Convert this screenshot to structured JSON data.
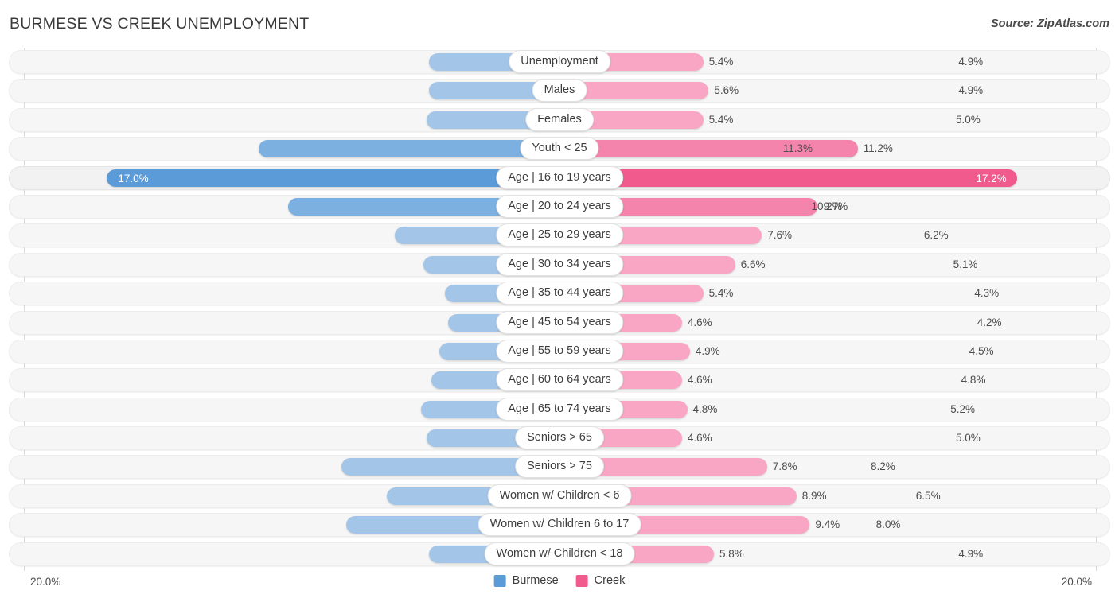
{
  "header": {
    "title": "BURMESE VS CREEK UNEMPLOYMENT",
    "source": "Source: ZipAtlas.com"
  },
  "footer": {
    "axis_left": "20.0%",
    "axis_right": "20.0%",
    "legend": [
      {
        "label": "Burmese",
        "color": "#5b9bd8",
        "icon": "legend-swatch"
      },
      {
        "label": "Creek",
        "color": "#f05a8c",
        "icon": "legend-swatch"
      }
    ]
  },
  "chart_data": {
    "type": "bar",
    "subtype": "diverging-bidirectional",
    "title": "BURMESE VS CREEK UNEMPLOYMENT",
    "xlabel": "",
    "ylabel": "",
    "xlim": [
      0,
      20.0
    ],
    "axis_max_label": "20.0%",
    "grid": false,
    "legend_position": "bottom-center",
    "series": [
      {
        "name": "Burmese",
        "side": "left",
        "color": "#5b9bd8",
        "values": [
          4.9,
          4.9,
          5.0,
          11.3,
          17.0,
          10.2,
          6.2,
          5.1,
          4.3,
          4.2,
          4.5,
          4.8,
          5.2,
          5.0,
          8.2,
          6.5,
          8.0,
          4.9
        ]
      },
      {
        "name": "Creek",
        "side": "right",
        "color": "#f05a8c",
        "values": [
          5.4,
          5.6,
          5.4,
          11.2,
          17.2,
          9.7,
          7.6,
          6.6,
          5.4,
          4.6,
          4.9,
          4.6,
          4.8,
          4.6,
          7.8,
          8.9,
          9.4,
          5.8
        ]
      }
    ],
    "categories": [
      "Unemployment",
      "Males",
      "Females",
      "Youth < 25",
      "Age | 16 to 19 years",
      "Age | 20 to 24 years",
      "Age | 25 to 29 years",
      "Age | 30 to 34 years",
      "Age | 35 to 44 years",
      "Age | 45 to 54 years",
      "Age | 55 to 59 years",
      "Age | 60 to 64 years",
      "Age | 65 to 74 years",
      "Seniors > 65",
      "Seniors > 75",
      "Women w/ Children < 6",
      "Women w/ Children 6 to 17",
      "Women w/ Children < 18"
    ],
    "rows": [
      {
        "label": "Unemployment",
        "left": "4.9%",
        "right": "5.4%",
        "left_val": 4.9,
        "right_val": 5.4,
        "style": "norm"
      },
      {
        "label": "Males",
        "left": "4.9%",
        "right": "5.6%",
        "left_val": 4.9,
        "right_val": 5.6,
        "style": "norm"
      },
      {
        "label": "Females",
        "left": "5.0%",
        "right": "5.4%",
        "left_val": 5.0,
        "right_val": 5.4,
        "style": "norm"
      },
      {
        "label": "Youth < 25",
        "left": "11.3%",
        "right": "11.2%",
        "left_val": 11.3,
        "right_val": 11.2,
        "style": "mid"
      },
      {
        "label": "Age | 16 to 19 years",
        "left": "17.0%",
        "right": "17.2%",
        "left_val": 17.0,
        "right_val": 17.2,
        "style": "max"
      },
      {
        "label": "Age | 20 to 24 years",
        "left": "10.2%",
        "right": "9.7%",
        "left_val": 10.2,
        "right_val": 9.7,
        "style": "mid"
      },
      {
        "label": "Age | 25 to 29 years",
        "left": "6.2%",
        "right": "7.6%",
        "left_val": 6.2,
        "right_val": 7.6,
        "style": "norm"
      },
      {
        "label": "Age | 30 to 34 years",
        "left": "5.1%",
        "right": "6.6%",
        "left_val": 5.1,
        "right_val": 6.6,
        "style": "norm"
      },
      {
        "label": "Age | 35 to 44 years",
        "left": "4.3%",
        "right": "5.4%",
        "left_val": 4.3,
        "right_val": 5.4,
        "style": "norm"
      },
      {
        "label": "Age | 45 to 54 years",
        "left": "4.2%",
        "right": "4.6%",
        "left_val": 4.2,
        "right_val": 4.6,
        "style": "norm"
      },
      {
        "label": "Age | 55 to 59 years",
        "left": "4.5%",
        "right": "4.9%",
        "left_val": 4.5,
        "right_val": 4.9,
        "style": "norm"
      },
      {
        "label": "Age | 60 to 64 years",
        "left": "4.8%",
        "right": "4.6%",
        "left_val": 4.8,
        "right_val": 4.6,
        "style": "norm"
      },
      {
        "label": "Age | 65 to 74 years",
        "left": "5.2%",
        "right": "4.8%",
        "left_val": 5.2,
        "right_val": 4.8,
        "style": "norm"
      },
      {
        "label": "Seniors > 65",
        "left": "5.0%",
        "right": "4.6%",
        "left_val": 5.0,
        "right_val": 4.6,
        "style": "norm"
      },
      {
        "label": "Seniors > 75",
        "left": "8.2%",
        "right": "7.8%",
        "left_val": 8.2,
        "right_val": 7.8,
        "style": "norm"
      },
      {
        "label": "Women w/ Children < 6",
        "left": "6.5%",
        "right": "8.9%",
        "left_val": 6.5,
        "right_val": 8.9,
        "style": "norm"
      },
      {
        "label": "Women w/ Children 6 to 17",
        "left": "8.0%",
        "right": "9.4%",
        "left_val": 8.0,
        "right_val": 9.4,
        "style": "norm"
      },
      {
        "label": "Women w/ Children < 18",
        "left": "4.9%",
        "right": "5.8%",
        "left_val": 4.9,
        "right_val": 5.8,
        "style": "norm"
      }
    ]
  }
}
